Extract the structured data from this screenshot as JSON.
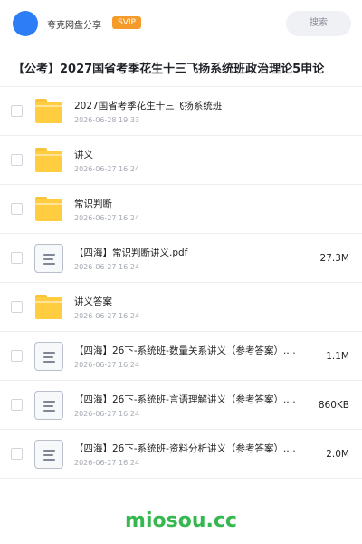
{
  "header": {
    "share_title": "夸克网盘分享",
    "badge": "SVIP",
    "search_label": "搜索"
  },
  "folder": {
    "title": "【公考】2027国省考季花生十三飞扬系统班政治理论5申论"
  },
  "files": [
    {
      "type": "folder",
      "name": "2027国省考季花生十三飞扬系统班",
      "date": "2026-06-28 19:33",
      "size": ""
    },
    {
      "type": "folder",
      "name": "讲义",
      "date": "2026-06-27 16:24",
      "size": ""
    },
    {
      "type": "folder",
      "name": "常识判断",
      "date": "2026-06-27 16:24",
      "size": ""
    },
    {
      "type": "file",
      "name": "【四海】常识判断讲义.pdf",
      "date": "2026-06-27 16:24",
      "size": "27.3M"
    },
    {
      "type": "folder",
      "name": "讲义答案",
      "date": "2026-06-27 16:24",
      "size": ""
    },
    {
      "type": "file",
      "name": "【四海】26下-系统班-数量关系讲义（参考答案）.…",
      "date": "2026-06-27 16:24",
      "size": "1.1M"
    },
    {
      "type": "file",
      "name": "【四海】26下-系统班-言语理解讲义（参考答案）.…",
      "date": "2026-06-27 16:24",
      "size": "860KB"
    },
    {
      "type": "file",
      "name": "【四海】26下-系统班-资料分析讲义（参考答案）.…",
      "date": "2026-06-27 16:24",
      "size": "2.0M"
    }
  ],
  "watermark": "miosou.cc",
  "colors": {
    "accent": "#2d7df6",
    "svip": "#f59b2b",
    "folder": "#ffcd3f",
    "watermark": "#34b84f"
  },
  "icons": {
    "folder": "folder-icon",
    "file": "document-icon"
  }
}
